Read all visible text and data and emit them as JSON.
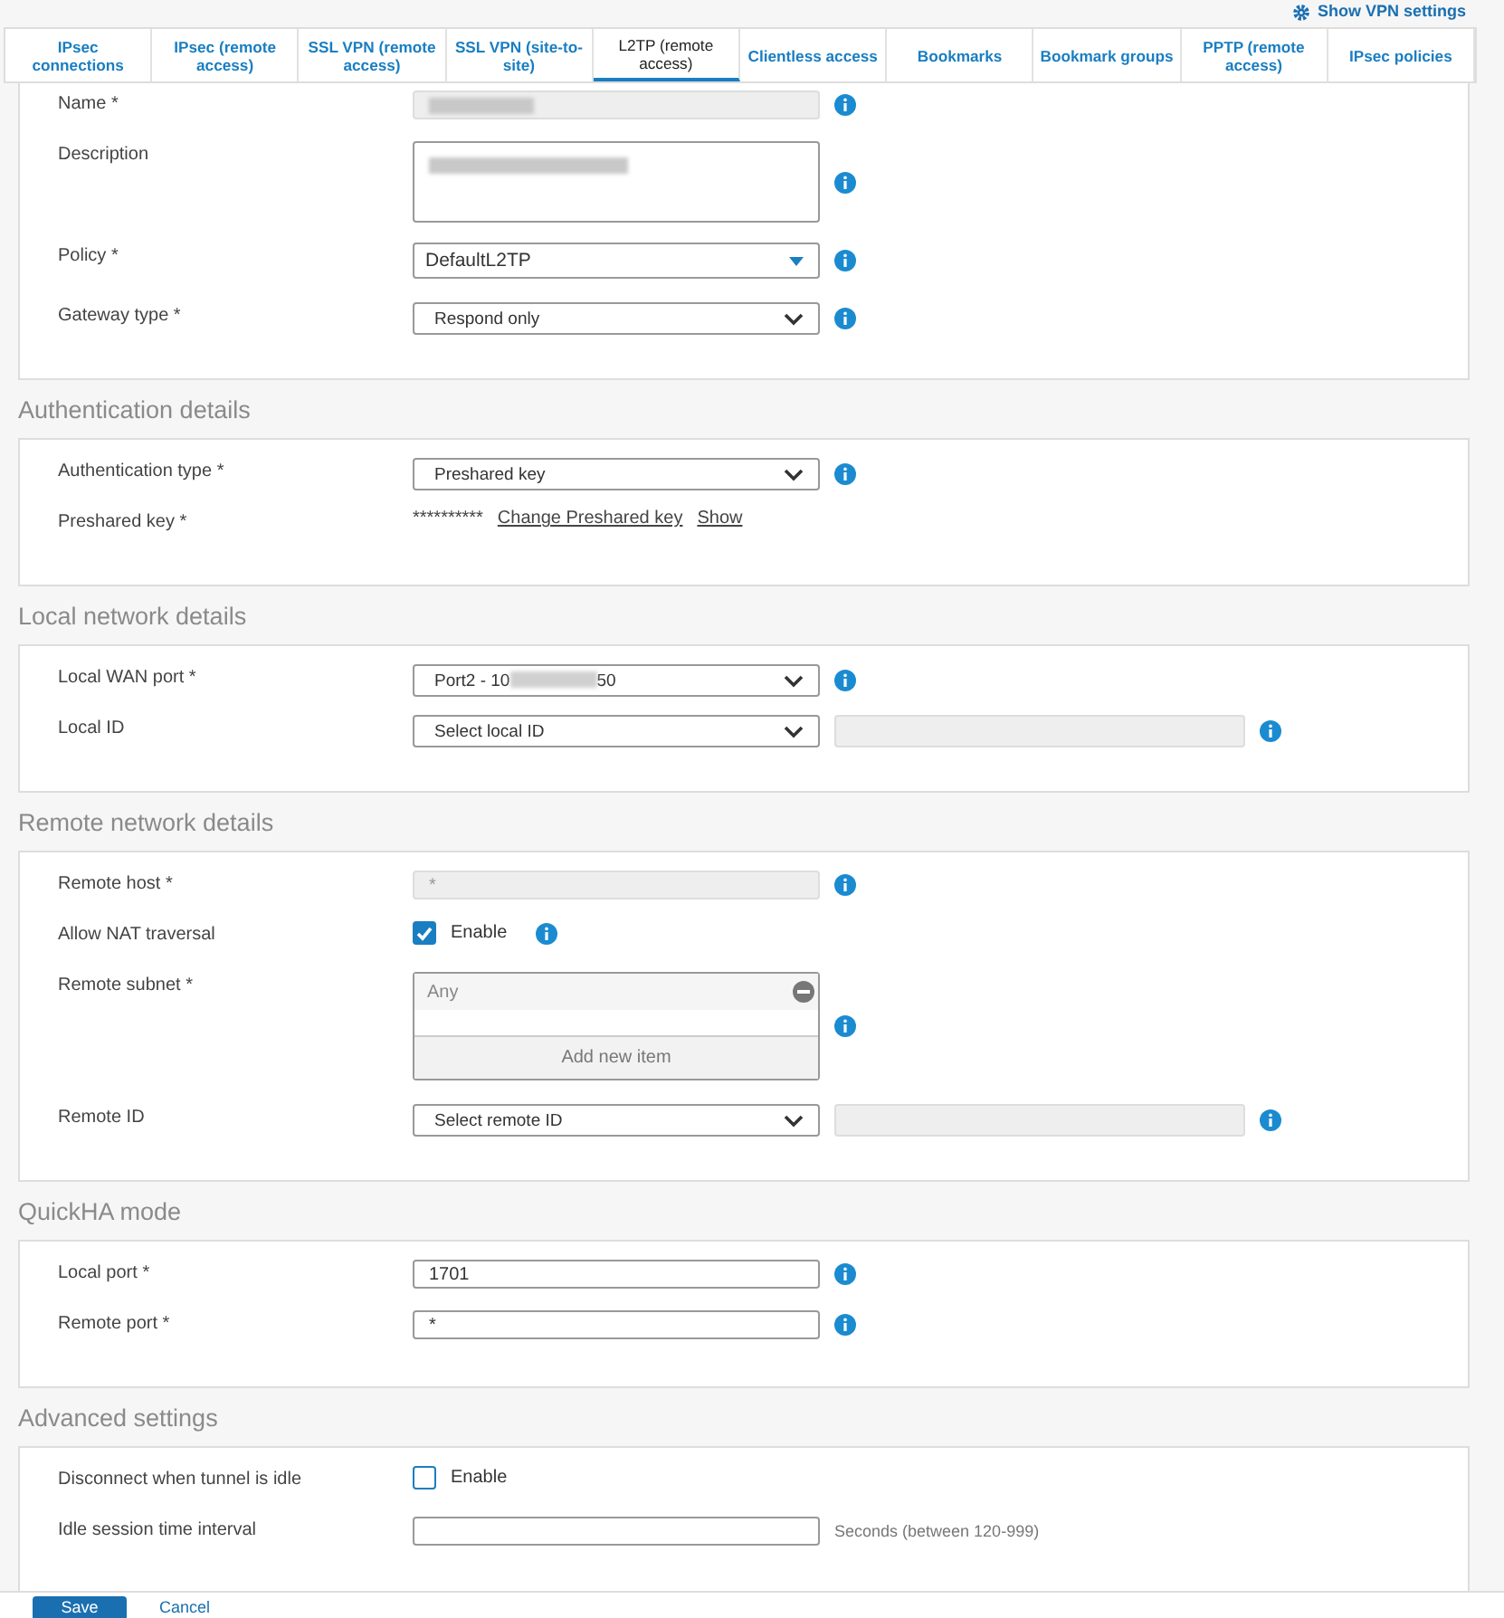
{
  "header_link": {
    "label": "Show VPN settings"
  },
  "tabs": [
    {
      "label": "IPsec connections",
      "selected": false
    },
    {
      "label": "IPsec (remote access)",
      "selected": false
    },
    {
      "label": "SSL VPN (remote access)",
      "selected": false
    },
    {
      "label": "SSL VPN (site-to-site)",
      "selected": false
    },
    {
      "label": "L2TP (remote access)",
      "selected": true
    },
    {
      "label": "Clientless access",
      "selected": false
    },
    {
      "label": "Bookmarks",
      "selected": false
    },
    {
      "label": "Bookmark groups",
      "selected": false
    },
    {
      "label": "PPTP (remote access)",
      "selected": false
    },
    {
      "label": "IPsec policies",
      "selected": false
    }
  ],
  "sections": [
    {
      "rows": [
        {
          "kind": "text",
          "label": "Name *",
          "redacted": true,
          "disabled": true,
          "info": true
        },
        {
          "kind": "textarea",
          "label": "Description",
          "redacted": true,
          "info": true
        },
        {
          "kind": "combo",
          "label": "Policy *",
          "value": "DefaultL2TP",
          "info": true
        },
        {
          "kind": "select",
          "label": "Gateway type *",
          "value": "Respond only",
          "info": true
        }
      ]
    },
    {
      "title": "Authentication details",
      "rows": [
        {
          "kind": "select",
          "label": "Authentication type *",
          "value": "Preshared key",
          "info": true
        },
        {
          "kind": "secret",
          "label": "Preshared key *",
          "value": "**********",
          "links": [
            "Change Preshared key",
            "Show"
          ]
        }
      ]
    },
    {
      "title": "Local network details",
      "rows": [
        {
          "kind": "select",
          "label": "Local WAN port *",
          "value": "Port2 - 10",
          "value_end": "50",
          "redacted": true,
          "info": true
        },
        {
          "kind": "select_field",
          "label": "Local ID",
          "value": "Select local ID",
          "info": true
        }
      ]
    },
    {
      "title": "Remote network details",
      "rows": [
        {
          "kind": "text",
          "label": "Remote host *",
          "value": "*",
          "disabled": true,
          "info": true
        },
        {
          "kind": "checkbox",
          "label": "Allow NAT traversal",
          "option": "Enable",
          "checked": true,
          "info": true
        },
        {
          "kind": "list",
          "label": "Remote subnet *",
          "items": [
            "Any"
          ],
          "add": "Add new item",
          "info": true
        },
        {
          "kind": "select_field",
          "label": "Remote ID",
          "value": "Select remote ID",
          "info": true
        }
      ]
    },
    {
      "title": "QuickHA mode",
      "rows": [
        {
          "kind": "text",
          "label": "Local port *",
          "value": "1701",
          "disabled": false,
          "info": true
        },
        {
          "kind": "text",
          "label": "Remote port *",
          "value": "*",
          "disabled": false,
          "info": true
        }
      ]
    },
    {
      "title": "Advanced settings",
      "rows": [
        {
          "kind": "checkbox",
          "label": "Disconnect when tunnel is idle",
          "option": "Enable",
          "checked": false,
          "info": false
        },
        {
          "kind": "text_hint",
          "label": "Idle session time interval",
          "value": "",
          "hint": "Seconds (between 120-999)"
        }
      ]
    }
  ],
  "footer": {
    "save": "Save",
    "cancel": "Cancel"
  }
}
